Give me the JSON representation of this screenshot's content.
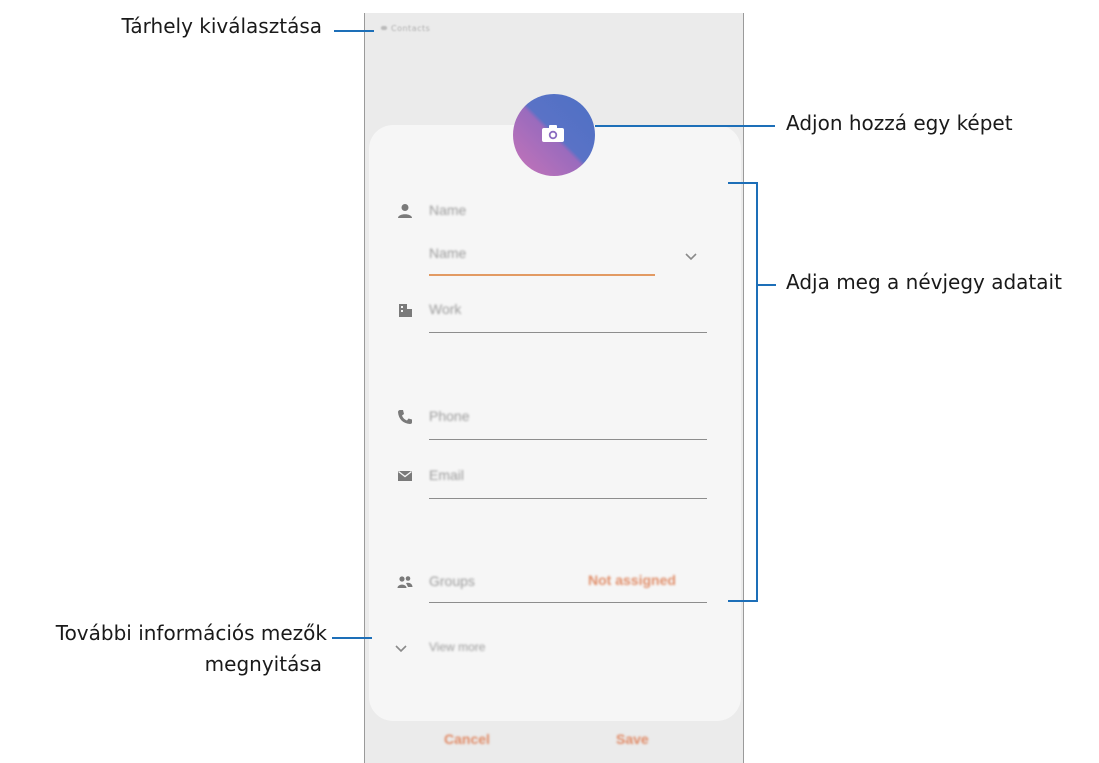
{
  "callouts": {
    "storage": "Tárhely kiválasztása",
    "add_image": "Adjon hozzá egy képet",
    "enter_details": "Adja meg a névjegy adatait",
    "more_fields_line1": "További információs mezők",
    "more_fields_line2": "megnyitása"
  },
  "screen": {
    "storage_label": "Contacts",
    "fields": {
      "name_header": "Name",
      "name_input": "Name",
      "work": "Work",
      "phone": "Phone",
      "email": "Email",
      "groups": "Groups",
      "groups_value": "Not assigned",
      "view_more": "View more"
    },
    "buttons": {
      "cancel": "Cancel",
      "save": "Save"
    }
  },
  "colors": {
    "accent": "#e08e6a",
    "callout_line": "#1d6fb8",
    "avatar_from": "#c774b8",
    "avatar_to": "#4d70c4"
  },
  "icons": [
    "camera-icon",
    "person-icon",
    "building-icon",
    "phone-icon",
    "mail-icon",
    "group-icon",
    "chevron-down-icon"
  ]
}
